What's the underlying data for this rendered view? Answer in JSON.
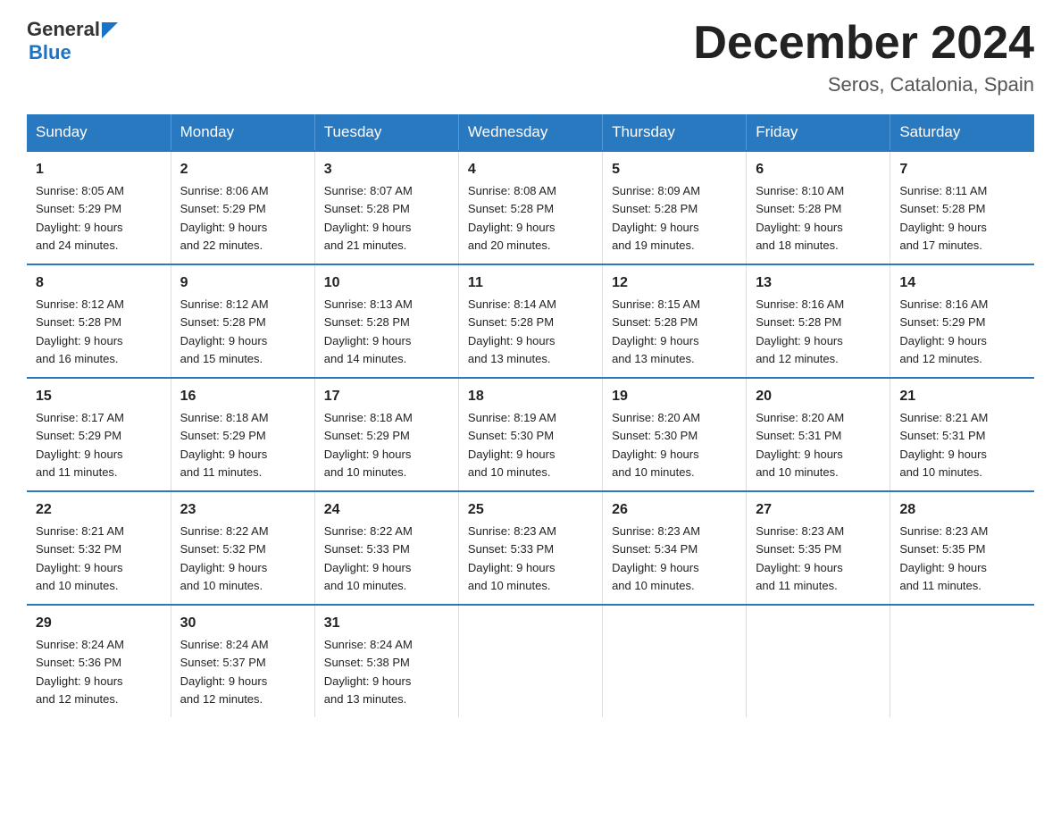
{
  "header": {
    "logo_text_general": "General",
    "logo_text_blue": "Blue",
    "month_title": "December 2024",
    "location": "Seros, Catalonia, Spain"
  },
  "weekdays": [
    "Sunday",
    "Monday",
    "Tuesday",
    "Wednesday",
    "Thursday",
    "Friday",
    "Saturday"
  ],
  "weeks": [
    [
      {
        "day": "1",
        "sunrise": "8:05 AM",
        "sunset": "5:29 PM",
        "daylight": "9 hours and 24 minutes."
      },
      {
        "day": "2",
        "sunrise": "8:06 AM",
        "sunset": "5:29 PM",
        "daylight": "9 hours and 22 minutes."
      },
      {
        "day": "3",
        "sunrise": "8:07 AM",
        "sunset": "5:28 PM",
        "daylight": "9 hours and 21 minutes."
      },
      {
        "day": "4",
        "sunrise": "8:08 AM",
        "sunset": "5:28 PM",
        "daylight": "9 hours and 20 minutes."
      },
      {
        "day": "5",
        "sunrise": "8:09 AM",
        "sunset": "5:28 PM",
        "daylight": "9 hours and 19 minutes."
      },
      {
        "day": "6",
        "sunrise": "8:10 AM",
        "sunset": "5:28 PM",
        "daylight": "9 hours and 18 minutes."
      },
      {
        "day": "7",
        "sunrise": "8:11 AM",
        "sunset": "5:28 PM",
        "daylight": "9 hours and 17 minutes."
      }
    ],
    [
      {
        "day": "8",
        "sunrise": "8:12 AM",
        "sunset": "5:28 PM",
        "daylight": "9 hours and 16 minutes."
      },
      {
        "day": "9",
        "sunrise": "8:12 AM",
        "sunset": "5:28 PM",
        "daylight": "9 hours and 15 minutes."
      },
      {
        "day": "10",
        "sunrise": "8:13 AM",
        "sunset": "5:28 PM",
        "daylight": "9 hours and 14 minutes."
      },
      {
        "day": "11",
        "sunrise": "8:14 AM",
        "sunset": "5:28 PM",
        "daylight": "9 hours and 13 minutes."
      },
      {
        "day": "12",
        "sunrise": "8:15 AM",
        "sunset": "5:28 PM",
        "daylight": "9 hours and 13 minutes."
      },
      {
        "day": "13",
        "sunrise": "8:16 AM",
        "sunset": "5:28 PM",
        "daylight": "9 hours and 12 minutes."
      },
      {
        "day": "14",
        "sunrise": "8:16 AM",
        "sunset": "5:29 PM",
        "daylight": "9 hours and 12 minutes."
      }
    ],
    [
      {
        "day": "15",
        "sunrise": "8:17 AM",
        "sunset": "5:29 PM",
        "daylight": "9 hours and 11 minutes."
      },
      {
        "day": "16",
        "sunrise": "8:18 AM",
        "sunset": "5:29 PM",
        "daylight": "9 hours and 11 minutes."
      },
      {
        "day": "17",
        "sunrise": "8:18 AM",
        "sunset": "5:29 PM",
        "daylight": "9 hours and 10 minutes."
      },
      {
        "day": "18",
        "sunrise": "8:19 AM",
        "sunset": "5:30 PM",
        "daylight": "9 hours and 10 minutes."
      },
      {
        "day": "19",
        "sunrise": "8:20 AM",
        "sunset": "5:30 PM",
        "daylight": "9 hours and 10 minutes."
      },
      {
        "day": "20",
        "sunrise": "8:20 AM",
        "sunset": "5:31 PM",
        "daylight": "9 hours and 10 minutes."
      },
      {
        "day": "21",
        "sunrise": "8:21 AM",
        "sunset": "5:31 PM",
        "daylight": "9 hours and 10 minutes."
      }
    ],
    [
      {
        "day": "22",
        "sunrise": "8:21 AM",
        "sunset": "5:32 PM",
        "daylight": "9 hours and 10 minutes."
      },
      {
        "day": "23",
        "sunrise": "8:22 AM",
        "sunset": "5:32 PM",
        "daylight": "9 hours and 10 minutes."
      },
      {
        "day": "24",
        "sunrise": "8:22 AM",
        "sunset": "5:33 PM",
        "daylight": "9 hours and 10 minutes."
      },
      {
        "day": "25",
        "sunrise": "8:23 AM",
        "sunset": "5:33 PM",
        "daylight": "9 hours and 10 minutes."
      },
      {
        "day": "26",
        "sunrise": "8:23 AM",
        "sunset": "5:34 PM",
        "daylight": "9 hours and 10 minutes."
      },
      {
        "day": "27",
        "sunrise": "8:23 AM",
        "sunset": "5:35 PM",
        "daylight": "9 hours and 11 minutes."
      },
      {
        "day": "28",
        "sunrise": "8:23 AM",
        "sunset": "5:35 PM",
        "daylight": "9 hours and 11 minutes."
      }
    ],
    [
      {
        "day": "29",
        "sunrise": "8:24 AM",
        "sunset": "5:36 PM",
        "daylight": "9 hours and 12 minutes."
      },
      {
        "day": "30",
        "sunrise": "8:24 AM",
        "sunset": "5:37 PM",
        "daylight": "9 hours and 12 minutes."
      },
      {
        "day": "31",
        "sunrise": "8:24 AM",
        "sunset": "5:38 PM",
        "daylight": "9 hours and 13 minutes."
      },
      null,
      null,
      null,
      null
    ]
  ],
  "labels": {
    "sunrise": "Sunrise:",
    "sunset": "Sunset:",
    "daylight": "Daylight:"
  }
}
